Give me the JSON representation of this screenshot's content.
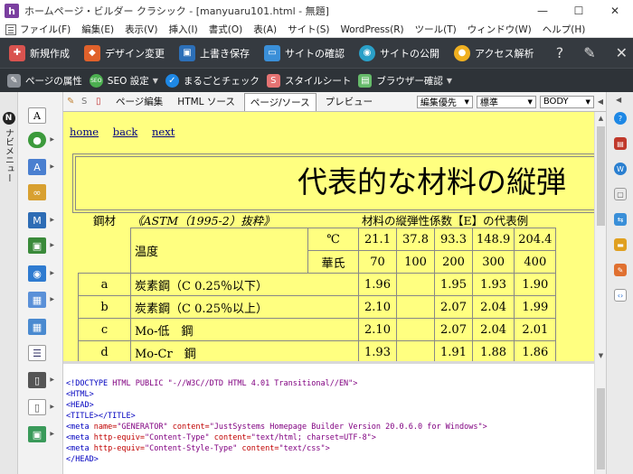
{
  "window": {
    "app_icon": "h",
    "title": "ホームページ・ビルダー クラシック - [manyuaru101.html - 無題]",
    "controls": [
      "minimize-icon",
      "maximize-icon",
      "close-icon"
    ]
  },
  "menu": [
    "ファイル(F)",
    "編集(E)",
    "表示(V)",
    "挿入(I)",
    "書式(O)",
    "表(A)",
    "サイト(S)",
    "WordPress(R)",
    "ツール(T)",
    "ウィンドウ(W)",
    "ヘルプ(H)"
  ],
  "toolbar1": {
    "new": "新規作成",
    "design": "デザイン変更",
    "overwrite": "上書き保存",
    "site_check": "サイトの確認",
    "site_publish": "サイトの公開",
    "access": "アクセス解析",
    "right_icons": [
      "help-icon",
      "pin-icon",
      "close-icon"
    ]
  },
  "toolbar2": {
    "page_props": "ページの属性",
    "seo": "SEO 設定",
    "check": "まるごとチェック",
    "stylesheet": "スタイルシート",
    "browser": "ブラウザー確認"
  },
  "leftnav": {
    "logo": "N",
    "label": "ナビメニュー"
  },
  "editor_tabs": {
    "page_edit": "ページ編集",
    "html_source": "HTML ソース",
    "page_source": "ページ/ソース",
    "preview": "プレビュー",
    "mode": "編集優先",
    "style": "標準",
    "tag": "BODY"
  },
  "page": {
    "links": [
      "home",
      "back",
      "next"
    ],
    "heading": "代表的な材料の縦弾",
    "caption_left": "鋼材",
    "caption_mid": "《ASTM（1995-2）抜粋》",
    "caption_right": "材料の縦弾性係数【E】の代表例",
    "temp_label": "温度",
    "celsius_label": "℃",
    "fahrenheit_label": "華氏",
    "celsius": [
      "21.1",
      "37.8",
      "93.3",
      "148.9",
      "204.4"
    ],
    "fahrenheit": [
      "70",
      "100",
      "200",
      "300",
      "400"
    ],
    "rows": [
      {
        "key": "a",
        "name": "炭素鋼（C 0.25％以下）",
        "vals": [
          "1.96",
          "",
          "1.95",
          "1.93",
          "1.90"
        ]
      },
      {
        "key": "b",
        "name": "炭素鋼（C 0.25％以上）",
        "vals": [
          "2.10",
          "",
          "2.07",
          "2.04",
          "1.99"
        ]
      },
      {
        "key": "c",
        "name": "Mo-低　鋼",
        "vals": [
          "2.10",
          "",
          "2.07",
          "2.04",
          "2.01"
        ]
      },
      {
        "key": "d",
        "name": "Mo-Cr　鋼",
        "vals": [
          "1.93",
          "",
          "1.91",
          "1.88",
          "1.86"
        ]
      }
    ]
  },
  "source": {
    "l1a": "<!DOCTYPE",
    "l1b": "HTML PUBLIC \"-//W3C//DTD HTML 4.01 Transitional//EN\">",
    "l2": "<HTML>",
    "l3": "<HEAD>",
    "l4": "<TITLE></TITLE>",
    "l5a": "<meta",
    "l5b": "name=",
    "l5c": "\"GENERATOR\"",
    "l5d": "content=",
    "l5e": "\"JustSystems Homepage Builder Version 20.0.6.0 for Windows\">",
    "l6a": "<meta",
    "l6b": "http-equiv=",
    "l6c": "\"Content-Type\"",
    "l6d": "content=",
    "l6e": "\"text/html; charset=UTF-8\">",
    "l7a": "<meta",
    "l7b": "http-equiv=",
    "l7c": "\"Content-Style-Type\"",
    "l7d": "content=",
    "l7e": "\"text/css\">",
    "l8": "</HEAD>"
  },
  "colors": {
    "toolbar_dark": "#353a40",
    "preview_bg": "#ffff80",
    "link": "#000080"
  }
}
